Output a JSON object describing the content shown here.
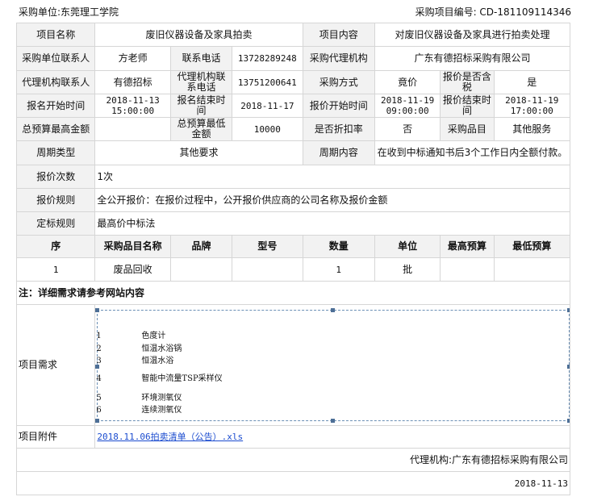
{
  "header": {
    "purchaser_label": "采购单位:东莞理工学院",
    "project_no": "采购项目编号: CD-181109114346"
  },
  "rows": {
    "project_name_label": "项目名称",
    "project_name": "废旧仪器设备及家具拍卖",
    "project_content_label": "项目内容",
    "project_content": "对废旧仪器设备及家具进行拍卖处理",
    "contact_label": "采购单位联系人",
    "contact": "方老师",
    "phone_label": "联系电话",
    "phone": "13728289248",
    "agency_label": "采购代理机构",
    "agency": "广东有德招标采购有限公司",
    "agency_contact_label": "代理机构联系人",
    "agency_contact": "有德招标",
    "agency_phone_label": "代理机构联系电话",
    "agency_phone": "13751200641",
    "method_label": "采购方式",
    "method": "竟价",
    "tax_label": "报价是否含税",
    "tax": "是",
    "signup_start_label": "报名开始时间",
    "signup_start": "2018-11-13 15:00:00",
    "signup_end_label": "报名结束时间",
    "signup_end": "2018-11-17",
    "quote_start_label": "报价开始时间",
    "quote_start": "2018-11-19 09:00:00",
    "quote_end_label": "报价结束时间",
    "quote_end": "2018-11-19 17:00:00",
    "max_budget_label": "总预算最高金额",
    "max_budget": "",
    "min_budget_label": "总预算最低金额",
    "min_budget": "10000",
    "discount_label": "是否折扣率",
    "discount": "否",
    "category_label": "采购品目",
    "category": "其他服务",
    "period_type_label": "周期类型",
    "period_type": "其他要求",
    "period_content_label": "周期内容",
    "period_content": "在收到中标通知书后3个工作日内全额付款。",
    "quote_count_label": "报价次数",
    "quote_count": "1次",
    "quote_rule_label": "报价规则",
    "quote_rule": "全公开报价：在报价过程中，公开报价供应商的公司名称及报价金额",
    "award_rule_label": "定标规则",
    "award_rule": "最高价中标法"
  },
  "items_table": {
    "headers": [
      "序",
      "采购品目名称",
      "品牌",
      "型号",
      "数量",
      "单位",
      "最高预算",
      "最低预算"
    ],
    "row": [
      "1",
      "废品回收",
      "",
      "",
      "1",
      "批",
      "",
      ""
    ]
  },
  "note": "注：详细需求请参考网站内容",
  "requirements": {
    "label": "项目需求",
    "items": [
      {
        "num": "1",
        "name": "色度计"
      },
      {
        "num": "2",
        "name": "恒温水浴锅"
      },
      {
        "num": "3",
        "name": "恒温水浴"
      },
      {
        "num": "4",
        "name": "智能中流量TSP采样仪"
      },
      {
        "num": "5",
        "name": "环境测氧仪"
      },
      {
        "num": "6",
        "name": "连续测氧仪"
      }
    ]
  },
  "attachment": {
    "label": "项目附件",
    "file": "2018.11.06拍卖清单（公告）.xls"
  },
  "footer": {
    "agency": "代理机构:广东有德招标采购有限公司",
    "date": "2018-11-13"
  }
}
